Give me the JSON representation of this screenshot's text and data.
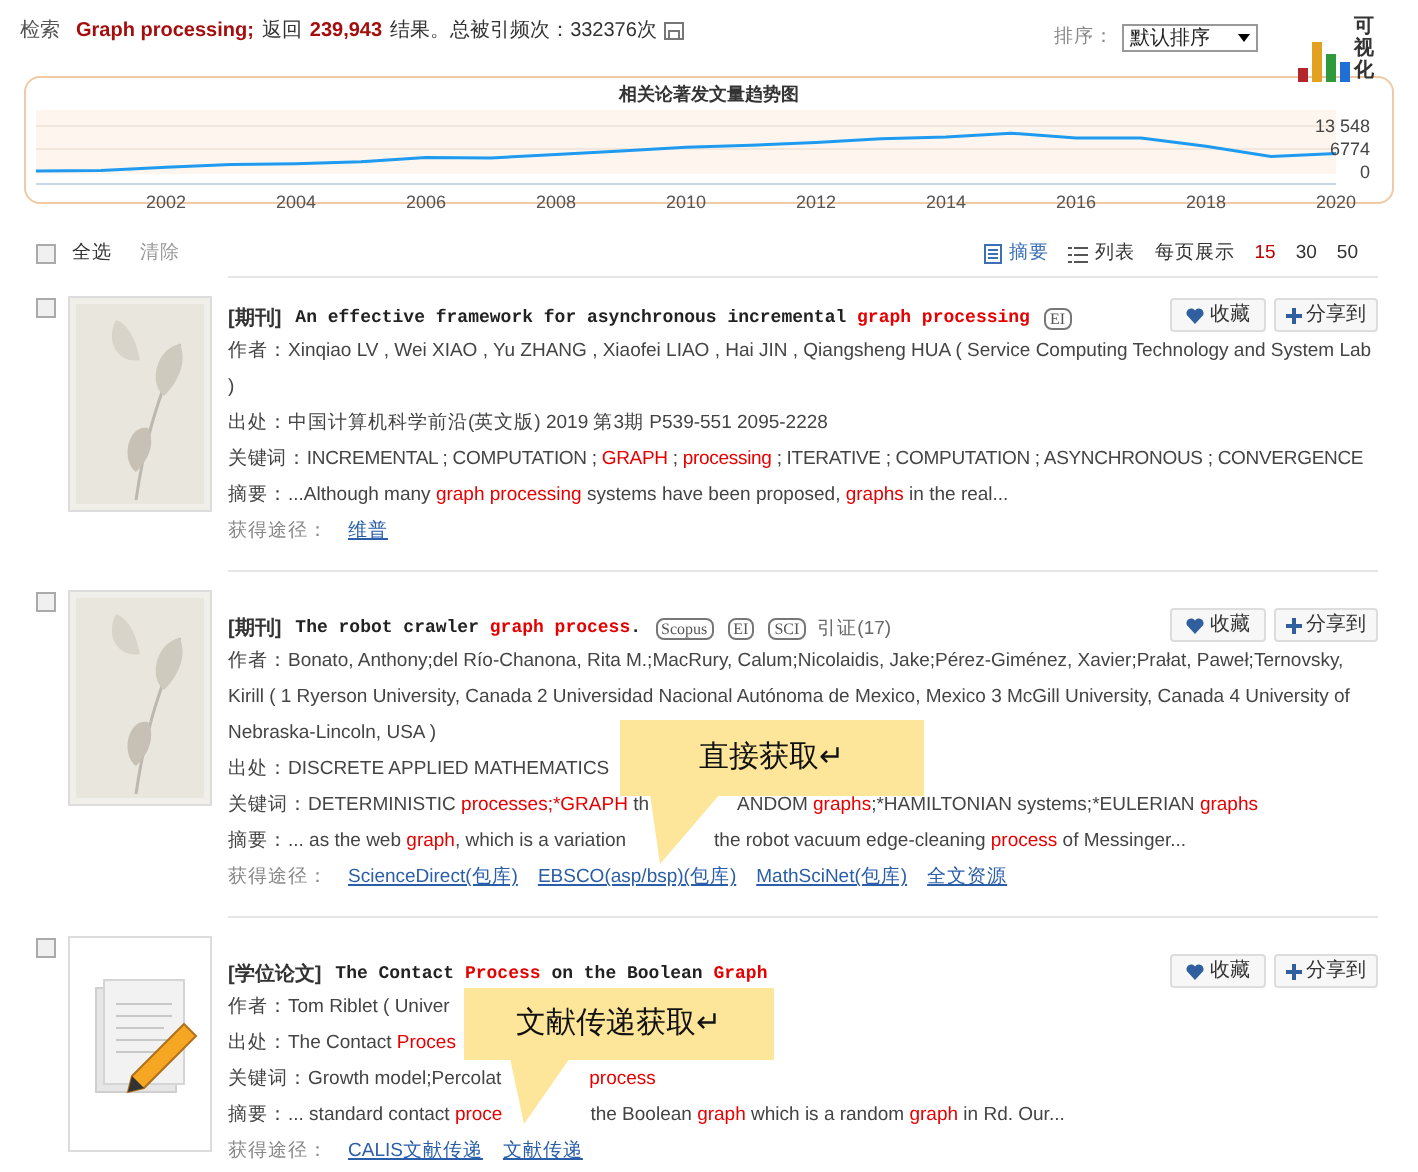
{
  "summary": {
    "label": "检索",
    "query": "Graph processing;",
    "returned": "返回",
    "count": "239,943",
    "tail": "结果。总被引频次：332376次"
  },
  "sort": {
    "label": "排序：",
    "value": "默认排序"
  },
  "visualize": {
    "label": "可视化"
  },
  "trend": {
    "title": "相关论著发文量趋势图",
    "chart_data": {
      "type": "line",
      "x": [
        2000,
        2001,
        2002,
        2003,
        2004,
        2005,
        2006,
        2007,
        2008,
        2009,
        2010,
        2011,
        2012,
        2013,
        2014,
        2015,
        2016,
        2017,
        2018,
        2019,
        2020
      ],
      "series": [
        {
          "color": "#1e9bf0",
          "values": [
            300,
            500,
            1400,
            2200,
            2400,
            3000,
            4300,
            4100,
            5200,
            6200,
            7300,
            7900,
            8700,
            9800,
            10300,
            11400,
            10000,
            10000,
            7600,
            4600,
            5400
          ]
        }
      ],
      "xticks": [
        2002,
        2004,
        2006,
        2008,
        2010,
        2012,
        2014,
        2016,
        2018,
        2020
      ],
      "xlim": [
        2000,
        2020
      ],
      "yticks": [
        {
          "value": 0,
          "label": "0"
        },
        {
          "value": 6774,
          "label": "6774"
        },
        {
          "value": 13548,
          "label": "13 548"
        }
      ],
      "ylim": [
        0,
        13548
      ]
    }
  },
  "toolbar": {
    "select_all": {
      "label": "全选",
      "checked": false
    },
    "clear": "清除",
    "views": [
      {
        "label": "摘要",
        "kind": "summary",
        "selected": true
      },
      {
        "label": "列表",
        "kind": "list",
        "selected": false
      }
    ],
    "per_page_label": "每页展示",
    "per_page": [
      {
        "label": "15",
        "selected": true
      },
      {
        "label": "30",
        "selected": false
      },
      {
        "label": "50",
        "selected": false
      }
    ]
  },
  "results": [
    {
      "checked": false,
      "thumbnail": {
        "kind": "leaf"
      },
      "type": "[期刊]",
      "title": [
        {
          "text": "An effective framework for asynchronous incremental ",
          "highlight": false
        },
        {
          "text": "graph processing",
          "highlight": true
        }
      ],
      "badges": [
        "EI"
      ],
      "authors": {
        "fragments": [
          [
            {
              "text": "作者：Xinqiao LV , Wei XIAO , Yu ZHANG , Xiaofei LIAO , Hai JIN , Qiangsheng HUA ( Service Computing Technology and System Lab )",
              "highlight": false
            }
          ]
        ]
      },
      "source": {
        "fragments": [
          [
            {
              "text": "出处：中国计算机科学前沿(英文版) 2019 第3期 P539-551  2095-2228",
              "highlight": false
            }
          ]
        ]
      },
      "keywords": {
        "fragments": [
          [
            {
              "text": "关键词：INCREMENTAL ; COMPUTATION ; ",
              "highlight": false
            },
            {
              "text": "GRAPH",
              "highlight": true
            },
            {
              "text": " ; ",
              "highlight": false
            },
            {
              "text": "processing",
              "highlight": true
            },
            {
              "text": " ; ITERATIVE ; COMPUTATION ; ASYNCHRONOUS ; CONVERGENCE",
              "highlight": false
            }
          ]
        ]
      },
      "abstract": {
        "fragments": [
          [
            {
              "text": "摘要：...Although many ",
              "highlight": false
            },
            {
              "text": "graph processing",
              "highlight": true
            },
            {
              "text": " systems have been proposed, ",
              "highlight": false
            },
            {
              "text": "graphs",
              "highlight": true
            },
            {
              "text": " in the real...",
              "highlight": false
            }
          ]
        ]
      },
      "access": {
        "label": "获得途径：",
        "links": [
          "维普"
        ]
      },
      "save": "收藏",
      "share": "分享到"
    },
    {
      "checked": false,
      "thumbnail": {
        "kind": "leaf"
      },
      "type": "[期刊]",
      "title": [
        {
          "text": "The robot crawler ",
          "highlight": false
        },
        {
          "text": "graph process",
          "highlight": true
        },
        {
          "text": ".",
          "highlight": false
        }
      ],
      "badges": [
        "Scopus",
        "EI",
        "SCI"
      ],
      "citation": "引证(17)",
      "authors": {
        "fragments": [
          [
            {
              "text": "作者：Bonato, Anthony;del Río-Chanona, Rita M.;MacRury, Calum;Nicolaidis, Jake;Pérez-Giménez, Xavier;Prałat, Paweł;Ternovsky, Kirill ( 1 Ryerson University, Canada 2 Universidad Nacional Autónoma de Mexico, Mexico 3 McGill University, Canada 4 University of Nebraska-Lincoln, USA )",
              "highlight": false
            }
          ]
        ]
      },
      "source": {
        "fragments": [
          [
            {
              "text": "出处：DISCRETE APPLIED MATHEMATICS",
              "highlight": false
            }
          ]
        ]
      },
      "keywords": {
        "fragments": [
          [
            {
              "text": "关键词：DETERMINISTIC ",
              "highlight": false
            },
            {
              "text": "processes;*GRAPH",
              "highlight": true
            },
            {
              "text": " th",
              "highlight": false
            }
          ],
          [
            {
              "text": "ANDOM ",
              "highlight": false
            },
            {
              "text": "graphs",
              "highlight": true
            },
            {
              "text": ";*HAMILTONIAN systems;*EULERIAN ",
              "highlight": false
            },
            {
              "text": "graphs",
              "highlight": true
            }
          ]
        ]
      },
      "abstract": {
        "fragments": [
          [
            {
              "text": "摘要：... as the web ",
              "highlight": false
            },
            {
              "text": "graph",
              "highlight": true
            },
            {
              "text": ", which is a variation",
              "highlight": false
            }
          ],
          [
            {
              "text": "the robot vacuum edge-cleaning ",
              "highlight": false
            },
            {
              "text": "process",
              "highlight": true
            },
            {
              "text": " of Messinger...",
              "highlight": false
            }
          ]
        ]
      },
      "access": {
        "label": "获得途径：",
        "links": [
          "ScienceDirect(包库)",
          "EBSCO(asp/bsp)(包库)",
          "MathSciNet(包库)",
          "全文资源"
        ]
      },
      "save": "收藏",
      "share": "分享到"
    },
    {
      "checked": false,
      "thumbnail": {
        "kind": "document"
      },
      "type": "[学位论文]",
      "title": [
        {
          "text": "The Contact ",
          "highlight": false
        },
        {
          "text": "Process",
          "highlight": true
        },
        {
          "text": " on the Boolean ",
          "highlight": false
        },
        {
          "text": "Graph",
          "highlight": true
        }
      ],
      "authors": {
        "fragments": [
          [
            {
              "text": "作者：Tom Riblet ( Univer",
              "highlight": false
            }
          ]
        ]
      },
      "source": {
        "fragments": [
          [
            {
              "text": "出处：The Contact ",
              "highlight": false
            },
            {
              "text": "Proces",
              "highlight": true
            }
          ]
        ]
      },
      "keywords": {
        "fragments": [
          [
            {
              "text": "关键词：Growth model;Percolat",
              "highlight": false
            }
          ],
          [
            {
              "text": "process",
              "highlight": true
            }
          ]
        ]
      },
      "abstract": {
        "fragments": [
          [
            {
              "text": "摘要：... standard contact ",
              "highlight": false
            },
            {
              "text": "proce",
              "highlight": true
            }
          ],
          [
            {
              "text": "the Boolean ",
              "highlight": false
            },
            {
              "text": "graph",
              "highlight": true
            },
            {
              "text": " which is a random ",
              "highlight": false
            },
            {
              "text": "graph",
              "highlight": true
            },
            {
              "text": " in Rd. Our...",
              "highlight": false
            }
          ]
        ]
      },
      "access": {
        "label": "获得途径：",
        "links": [
          "CALIS文献传递",
          "文献传递"
        ]
      },
      "save": "收藏",
      "share": "分享到"
    }
  ],
  "callouts": [
    {
      "text": "直接获取↵"
    },
    {
      "text": "文献传递获取↵"
    }
  ]
}
